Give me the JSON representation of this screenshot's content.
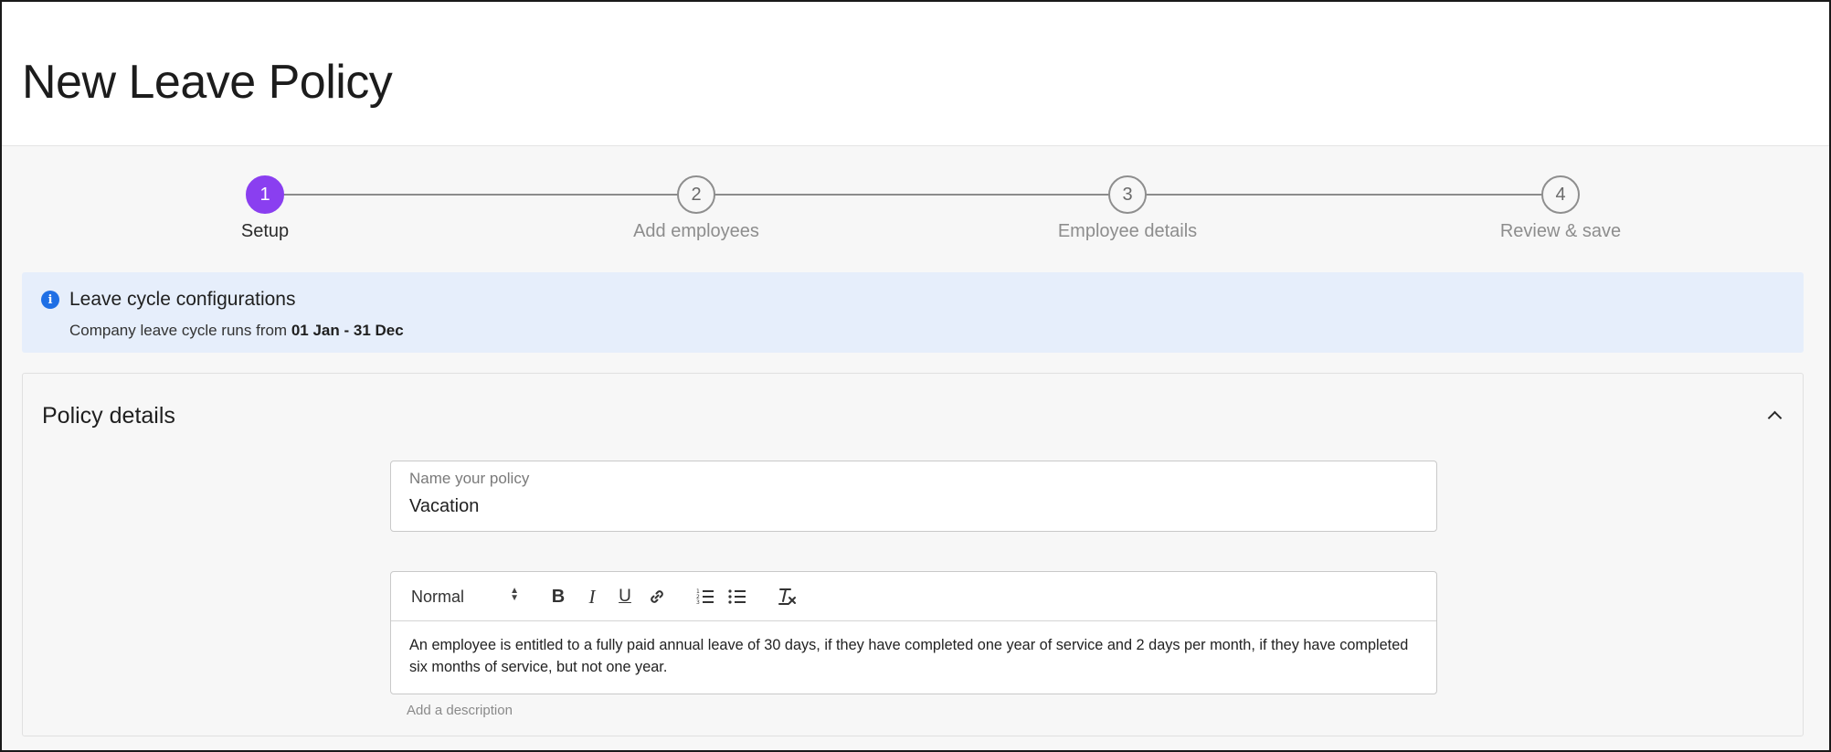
{
  "page": {
    "title": "New Leave Policy"
  },
  "stepper": {
    "steps": [
      {
        "number": "1",
        "label": "Setup",
        "active": true
      },
      {
        "number": "2",
        "label": "Add employees",
        "active": false
      },
      {
        "number": "3",
        "label": "Employee details",
        "active": false
      },
      {
        "number": "4",
        "label": "Review & save",
        "active": false
      }
    ]
  },
  "info_banner": {
    "title": "Leave cycle configurations",
    "text_prefix": "Company leave cycle runs from ",
    "text_range": "01 Jan - 31 Dec",
    "icon": "info-icon"
  },
  "policy_details": {
    "title": "Policy details",
    "collapse_icon": "chevron-up-icon",
    "name_field": {
      "label": "Name your policy",
      "value": "Vacation"
    },
    "description_editor": {
      "format_select": "Normal",
      "toolbar_icons": [
        "bold-icon",
        "italic-icon",
        "underline-icon",
        "link-icon",
        "ordered-list-icon",
        "bullet-list-icon",
        "clear-format-icon"
      ],
      "content": "An employee is entitled to a fully paid annual leave of 30 days, if they have completed one year of service and 2 days per month, if they have completed six months of service, but not one year.",
      "helper_text": "Add a description"
    }
  },
  "colors": {
    "accent": "#8a3ff0",
    "info_bg": "#e6eefb",
    "info_icon": "#1f6fe5"
  }
}
